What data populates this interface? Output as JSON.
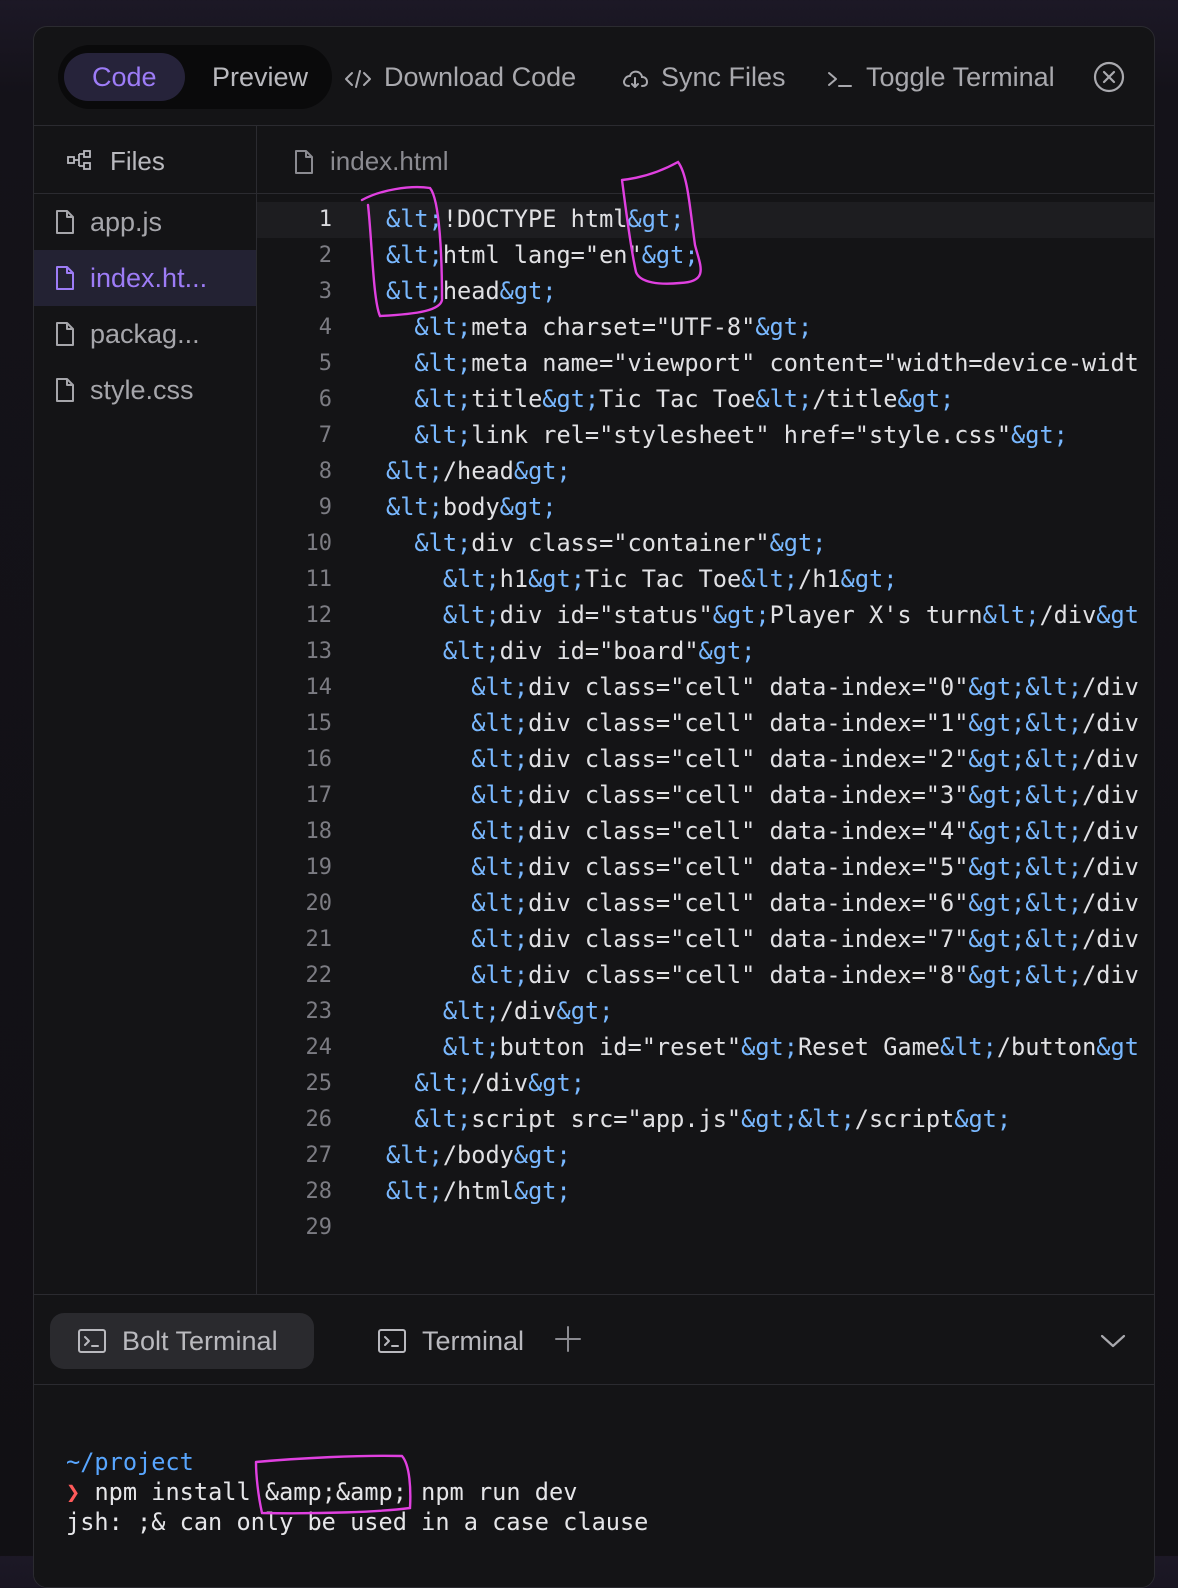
{
  "toolbar": {
    "code_label": "Code",
    "preview_label": "Preview",
    "download_label": "Download Code",
    "sync_label": "Sync Files",
    "terminal_label": "Toggle Terminal"
  },
  "files": {
    "header": "Files",
    "items": [
      "app.js",
      "index.ht...",
      "packag...",
      "style.css"
    ],
    "active": "index.ht..."
  },
  "editor": {
    "tab": "index.html",
    "lines": [
      "&lt;!DOCTYPE html&gt;",
      "&lt;html lang=\"en\"&gt;",
      "&lt;head&gt;",
      "  &lt;meta charset=\"UTF-8\"&gt;",
      "  &lt;meta name=\"viewport\" content=\"width=device-widt",
      "  &lt;title&gt;Tic Tac Toe&lt;/title&gt;",
      "  &lt;link rel=\"stylesheet\" href=\"style.css\"&gt;",
      "&lt;/head&gt;",
      "&lt;body&gt;",
      "  &lt;div class=\"container\"&gt;",
      "    &lt;h1&gt;Tic Tac Toe&lt;/h1&gt;",
      "    &lt;div id=\"status\"&gt;Player X's turn&lt;/div&gt",
      "    &lt;div id=\"board\"&gt;",
      "      &lt;div class=\"cell\" data-index=\"0\"&gt;&lt;/div",
      "      &lt;div class=\"cell\" data-index=\"1\"&gt;&lt;/div",
      "      &lt;div class=\"cell\" data-index=\"2\"&gt;&lt;/div",
      "      &lt;div class=\"cell\" data-index=\"3\"&gt;&lt;/div",
      "      &lt;div class=\"cell\" data-index=\"4\"&gt;&lt;/div",
      "      &lt;div class=\"cell\" data-index=\"5\"&gt;&lt;/div",
      "      &lt;div class=\"cell\" data-index=\"6\"&gt;&lt;/div",
      "      &lt;div class=\"cell\" data-index=\"7\"&gt;&lt;/div",
      "      &lt;div class=\"cell\" data-index=\"8\"&gt;&lt;/div",
      "    &lt;/div&gt;",
      "    &lt;button id=\"reset\"&gt;Reset Game&lt;/button&gt",
      "  &lt;/div&gt;",
      "  &lt;script src=\"app.js\"&gt;&lt;/script&gt;",
      "&lt;/body&gt;",
      "&lt;/html&gt;",
      ""
    ],
    "current_line": 1
  },
  "terminal": {
    "tabs": [
      "Bolt Terminal",
      "Terminal"
    ],
    "path": "~/project",
    "prompt_symbol": "❯",
    "command": "npm install &amp;&amp; npm run dev",
    "output": "jsh: ;& can only be used in a case clause"
  },
  "colors": {
    "accent": "#9d7cf7",
    "entity": "#79b8ff",
    "annotation": "#e040e0"
  }
}
